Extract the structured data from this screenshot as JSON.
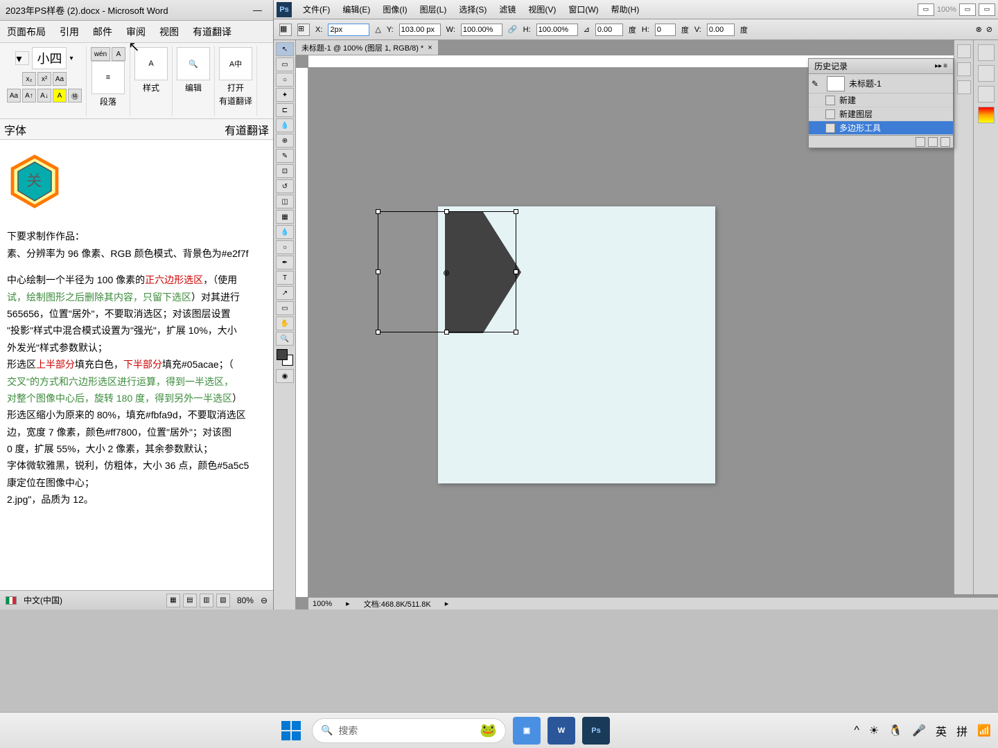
{
  "word": {
    "title": "2023年PS样卷 (2).docx - Microsoft Word",
    "menu": {
      "m1": "页面布局",
      "m2": "引用",
      "m3": "邮件",
      "m4": "审阅",
      "m5": "视图",
      "m6": "有道翻译"
    },
    "ribbon": {
      "font_size": "小四",
      "g1": "段落",
      "g2": "样式",
      "g3": "编辑",
      "g4": "打开",
      "g5": "有道翻译",
      "sub": "字体",
      "youdao": "有道翻译"
    },
    "doc": {
      "l1": "下要求制作作品：",
      "l2": "素、分辨率为 96 像素、RGB 颜色模式、背景色为#e2f7f",
      "l3a": "中心绘制一个半径为 100 像素的",
      "l3b": "正六边形选区",
      "l3c": "，（使用",
      "l4": "试，绘制图形之后删除其内容，只留下选区",
      "l4b": "）对其进行",
      "l5": "565656，位置\"居外\"，不要取消选区；对该图层设置",
      "l6": "\"投影\"样式中混合模式设置为\"强光\"，扩展 10%，大小",
      "l7": "外发光\"样式参数默认；",
      "l8a": "形选区",
      "l8b": "上半部分",
      "l8c": "填充白色，",
      "l8d": "下半部分",
      "l8e": "填充#05acae；（",
      "l9": "交叉\"的方式和六边形选区进行运算，得到一半选区，",
      "l10": "对整个图像中心后，旋转 180 度，得到另外一半选区",
      "l10b": "）",
      "l11": "形选区缩小为原来的 80%，填充#fbfa9d，不要取消选区",
      "l12": "边，宽度 7 像素，颜色#ff7800，位置\"居外\"；对该图",
      "l13": "0 度，扩展 55%，大小 2 像素，其余参数默认；",
      "l14": "字体微软雅黑，锐利，仿粗体，大小 36 点，颜色#5a5c5",
      "l15": "康定位在图像中心；",
      "l16": "2.jpg\"，品质为 12。"
    },
    "status": {
      "lang": "中文(中国)",
      "zoom": "80%"
    }
  },
  "ps": {
    "menu": {
      "m1": "文件(F)",
      "m2": "编辑(E)",
      "m3": "图像(I)",
      "m4": "图层(L)",
      "m5": "选择(S)",
      "m6": "滤镜",
      "m7": "视图(V)",
      "m8": "窗口(W)",
      "m9": "帮助(H)",
      "zoom": "100%"
    },
    "options": {
      "x_label": "X:",
      "x_val": "2px",
      "y_label": "Y:",
      "y_val": "103.00 px",
      "w_label": "W:",
      "w_val": "100.00%",
      "h_label": "H:",
      "h_val": "100.00%",
      "a_label": "",
      "a_val": "0.00",
      "deg": "度",
      "hl": "H:",
      "h2_val": "0",
      "vl": "V:",
      "v_val": "0.00"
    },
    "doctab": "未标题-1 @ 100% (图层 1, RGB/8) *",
    "status": {
      "zoom": "100%",
      "docsize": "文档:468.8K/511.8K"
    },
    "history": {
      "title": "历史记录",
      "snapshot": "未标题-1",
      "items": {
        "i1": "新建",
        "i2": "新建图层",
        "i3": "多边形工具"
      }
    }
  },
  "taskbar": {
    "search": "搜索",
    "ime1": "英",
    "ime2": "拼"
  }
}
